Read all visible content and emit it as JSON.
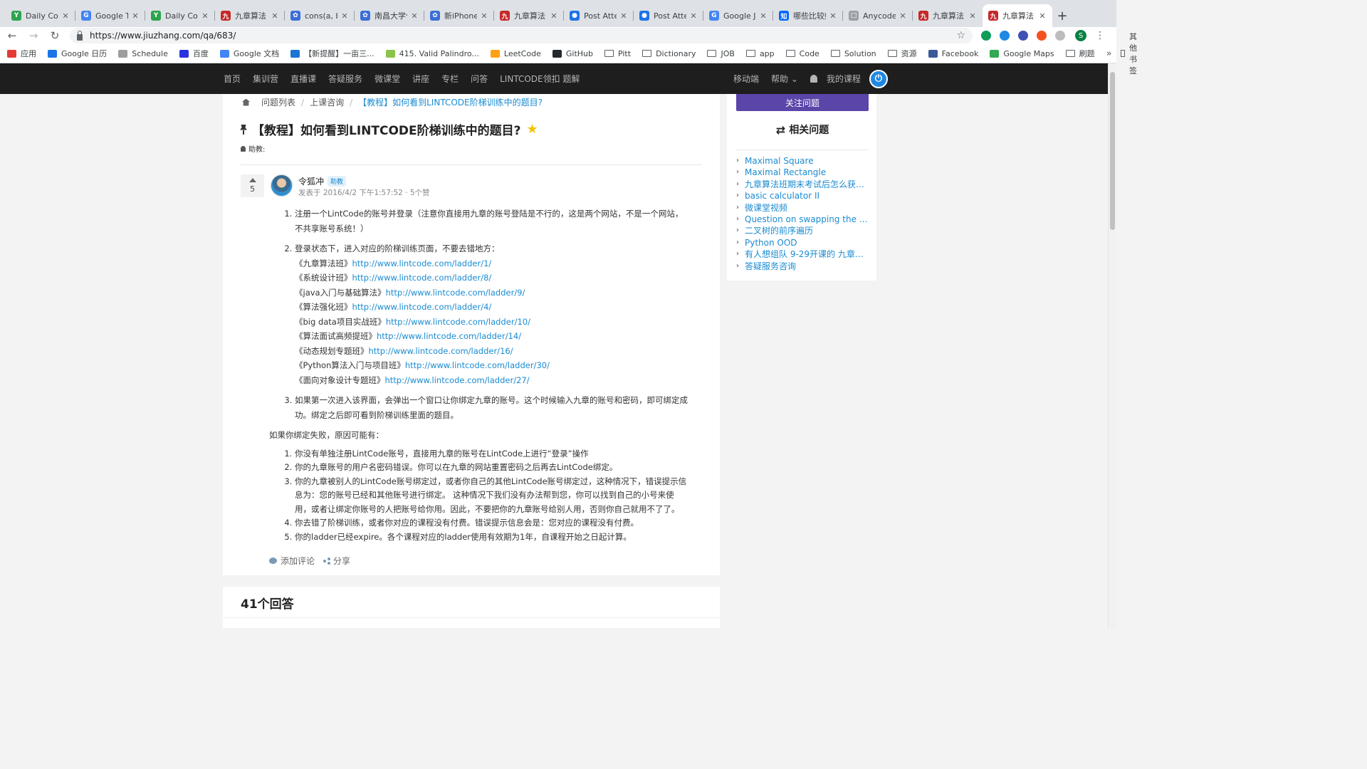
{
  "browser": {
    "tabs": [
      {
        "label": "Daily Cod",
        "favicon_color": "#2da44e",
        "glyph": "Y"
      },
      {
        "label": "Google Tr",
        "favicon_color": "#4285f4",
        "glyph": "G"
      },
      {
        "label": "Daily Cod",
        "favicon_color": "#2da44e",
        "glyph": "Y"
      },
      {
        "label": "九章算法 -",
        "favicon_color": "#c62828",
        "glyph": "九"
      },
      {
        "label": "cons(a, b)",
        "favicon_color": "#3b6fd6",
        "glyph": "✿"
      },
      {
        "label": "南昌大学化",
        "favicon_color": "#3b6fd6",
        "glyph": "✿"
      },
      {
        "label": "新iPhoneX",
        "favicon_color": "#3b6fd6",
        "glyph": "✿"
      },
      {
        "label": "九章算法 -",
        "favicon_color": "#c62828",
        "glyph": "九"
      },
      {
        "label": "Post Atten",
        "favicon_color": "#1e73e8",
        "glyph": "●"
      },
      {
        "label": "Post Atten",
        "favicon_color": "#1e73e8",
        "glyph": "●"
      },
      {
        "label": "Google Ja",
        "favicon_color": "#4285f4",
        "glyph": "G"
      },
      {
        "label": "哪些比较好",
        "favicon_color": "#0066ff",
        "glyph": "知"
      },
      {
        "label": "Anycodes",
        "favicon_color": "#9aa0a6",
        "glyph": "□"
      },
      {
        "label": "九章算法 -",
        "favicon_color": "#c62828",
        "glyph": "九"
      },
      {
        "label": "九章算法 -",
        "favicon_color": "#c62828",
        "glyph": "九"
      }
    ],
    "active_tab": 14,
    "new_tab": "+",
    "back": "←",
    "forward": "→",
    "reload": "↻",
    "url": "https://www.jiuzhang.com/qa/683/",
    "star": "☆",
    "extensions": [
      "#0f9d58",
      "#1e88e5",
      "#3f51b5",
      "#f4511e",
      "#bdbdbd"
    ],
    "profile_initial": "S",
    "menu": "⋮"
  },
  "bookmarks": {
    "items": [
      {
        "label": "应用",
        "color": "#e53935"
      },
      {
        "label": "Google 日历",
        "color": "#1a73e8"
      },
      {
        "label": "Schedule",
        "color": "#9e9e9e"
      },
      {
        "label": "百度",
        "color": "#2932e1"
      },
      {
        "label": "Google 文档",
        "color": "#4285f4"
      },
      {
        "label": "【新提醒】一亩三...",
        "color": "#1976d2"
      },
      {
        "label": "415. Valid Palindro...",
        "color": "#8bc34a"
      },
      {
        "label": "LeetCode",
        "color": "#ffa116"
      },
      {
        "label": "GitHub",
        "color": "#24292e"
      },
      {
        "label": "Pitt",
        "color": "folder"
      },
      {
        "label": "Dictionary",
        "color": "folder"
      },
      {
        "label": "JOB",
        "color": "folder"
      },
      {
        "label": "app",
        "color": "folder"
      },
      {
        "label": "Code",
        "color": "folder"
      },
      {
        "label": "Solution",
        "color": "folder"
      },
      {
        "label": "资源",
        "color": "folder"
      },
      {
        "label": "Facebook",
        "color": "#3b5998"
      },
      {
        "label": "Google Maps",
        "color": "#34a853"
      },
      {
        "label": "刷题",
        "color": "folder"
      }
    ],
    "more": "»",
    "other": "其他书签"
  },
  "site_nav": {
    "links": [
      "首页",
      "集训营",
      "直播课",
      "答疑服务",
      "微课堂",
      "讲座",
      "专栏",
      "问答",
      "LINTCODE领扣 题解"
    ],
    "right": {
      "mobile": "移动端",
      "help": "帮助",
      "help_caret": "⌄",
      "my_courses": "我的课程",
      "power": "⏻"
    }
  },
  "breadcrumb": {
    "items": [
      "问题列表",
      "上课咨询"
    ],
    "current": "【教程】如何看到LINTCODE阶梯训练中的题目?",
    "sep": "/"
  },
  "question": {
    "title": "【教程】如何看到LINTCODE阶梯训练中的题目?",
    "star": "★",
    "role_label": "助教:"
  },
  "answer": {
    "votes": "5",
    "author": "令狐冲",
    "badge": "助教",
    "meta": "发表于 2016/4/2 下午1:57:52 · 5个赞",
    "step1": "注册一个LintCode的账号并登录（注意你直接用九章的账号登陆是不行的，这是两个网站，不是一个网站，不共享账号系统！）",
    "step2_intro": "登录状态下，进入对应的阶梯训练页面，不要去错地方：",
    "ladders": [
      {
        "name": "《九章算法班》",
        "url": "http://www.lintcode.com/ladder/1/"
      },
      {
        "name": "《系统设计班》",
        "url": "http://www.lintcode.com/ladder/8/"
      },
      {
        "name": "《java入门与基础算法》",
        "url": "http://www.lintcode.com/ladder/9/"
      },
      {
        "name": "《算法强化班》",
        "url": "http://www.lintcode.com/ladder/4/"
      },
      {
        "name": "《big data项目实战班》",
        "url": "http://www.lintcode.com/ladder/10/"
      },
      {
        "name": "《算法面试高频提班》",
        "url": "http://www.lintcode.com/ladder/14/"
      },
      {
        "name": "《动态规划专题班》",
        "url": "http://www.lintcode.com/ladder/16/"
      },
      {
        "name": "《Python算法入门与项目班》",
        "url": "http://www.lintcode.com/ladder/30/"
      },
      {
        "name": "《面向对象设计专题班》",
        "url": "http://www.lintcode.com/ladder/27/"
      }
    ],
    "step3": "如果第一次进入该界面，会弹出一个窗口让你绑定九章的账号。这个时候输入九章的账号和密码，即可绑定成功。绑定之后即可看到阶梯训练里面的题目。",
    "fail_intro": "如果你绑定失败，原因可能有：",
    "reasons": [
      "你没有单独注册LintCode账号，直接用九章的账号在LintCode上进行“登录”操作",
      "你的九章账号的用户名密码错误。你可以在九章的网站重置密码之后再去LintCode绑定。",
      "你的九章被别人的LintCode账号绑定过，或者你自己的其他LintCode账号绑定过，这种情况下，错误提示信息为：您的账号已经和其他账号进行绑定。 这种情况下我们没有办法帮到您，你可以找到自己的小号来使用，或者让绑定你账号的人把账号给你用。因此，不要把你的九章账号给别人用，否则你自己就用不了了。",
      "你去错了阶梯训练，或者你对应的课程没有付费。错误提示信息会是：您对应的课程没有付费。",
      "你的ladder已经expire。各个课程对应的ladder使用有效期为1年，自课程开始之日起计算。"
    ],
    "add_comment": "添加评论",
    "share": "分享"
  },
  "answers_header": "41个回答",
  "sidebar": {
    "follow_button": "关注问题",
    "related_icon": "⇄",
    "related_title": "相关问题",
    "chevron": "›",
    "related": [
      "Maximal Square",
      "Maximal Rectangle",
      "九章算法班期末考试后怎么获得...",
      "basic calculator II",
      "微课堂视频",
      "Question on swapping the tw...",
      "二叉树的前序遍历",
      "Python OOD",
      "有人想组队 9-29开课的 九章算...",
      "答疑服务咨询"
    ]
  }
}
